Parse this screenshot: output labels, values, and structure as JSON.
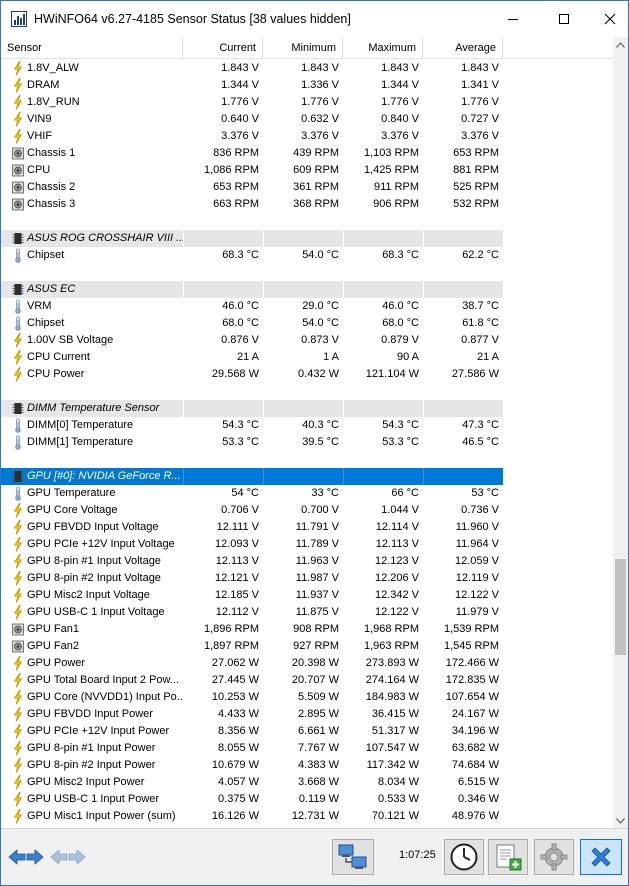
{
  "window": {
    "title": "HWiNFO64 v6.27-4185 Sensor Status [38 values hidden]",
    "minimize_icon": "minimize-icon",
    "maximize_icon": "maximize-icon",
    "close_icon": "close-icon"
  },
  "columns": [
    "Sensor",
    "Current",
    "Minimum",
    "Maximum",
    "Average"
  ],
  "rows": [
    {
      "kind": "data",
      "icon": "voltage",
      "label": "1.8V_ALW",
      "current": "1.843 V",
      "minimum": "1.843 V",
      "maximum": "1.843 V",
      "average": "1.843 V"
    },
    {
      "kind": "data",
      "icon": "voltage",
      "label": "DRAM",
      "current": "1.344 V",
      "minimum": "1.336 V",
      "maximum": "1.344 V",
      "average": "1.341 V"
    },
    {
      "kind": "data",
      "icon": "voltage",
      "label": "1.8V_RUN",
      "current": "1.776 V",
      "minimum": "1.776 V",
      "maximum": "1.776 V",
      "average": "1.776 V"
    },
    {
      "kind": "data",
      "icon": "voltage",
      "label": "VIN9",
      "current": "0.640 V",
      "minimum": "0.632 V",
      "maximum": "0.840 V",
      "average": "0.727 V"
    },
    {
      "kind": "data",
      "icon": "voltage",
      "label": "VHIF",
      "current": "3.376 V",
      "minimum": "3.376 V",
      "maximum": "3.376 V",
      "average": "3.376 V"
    },
    {
      "kind": "data",
      "icon": "fan",
      "label": "Chassis 1",
      "current": "836 RPM",
      "minimum": "439 RPM",
      "maximum": "1,103 RPM",
      "average": "653 RPM"
    },
    {
      "kind": "data",
      "icon": "fan",
      "label": "CPU",
      "current": "1,086 RPM",
      "minimum": "609 RPM",
      "maximum": "1,425 RPM",
      "average": "881 RPM"
    },
    {
      "kind": "data",
      "icon": "fan",
      "label": "Chassis 2",
      "current": "653 RPM",
      "minimum": "361 RPM",
      "maximum": "911 RPM",
      "average": "525 RPM"
    },
    {
      "kind": "data",
      "icon": "fan",
      "label": "Chassis 3",
      "current": "663 RPM",
      "minimum": "368 RPM",
      "maximum": "906 RPM",
      "average": "532 RPM"
    },
    {
      "kind": "blank"
    },
    {
      "kind": "group",
      "icon": "chip",
      "label": "ASUS ROG CROSSHAIR VIII ..."
    },
    {
      "kind": "data",
      "icon": "temperature",
      "label": "Chipset",
      "current": "68.3 °C",
      "minimum": "54.0 °C",
      "maximum": "68.3 °C",
      "average": "62.2 °C"
    },
    {
      "kind": "blank"
    },
    {
      "kind": "group",
      "icon": "chip",
      "label": "ASUS EC"
    },
    {
      "kind": "data",
      "icon": "temperature",
      "label": "VRM",
      "current": "46.0 °C",
      "minimum": "29.0 °C",
      "maximum": "46.0 °C",
      "average": "38.7 °C"
    },
    {
      "kind": "data",
      "icon": "temperature",
      "label": "Chipset",
      "current": "68.0 °C",
      "minimum": "54.0 °C",
      "maximum": "68.0 °C",
      "average": "61.8 °C"
    },
    {
      "kind": "data",
      "icon": "voltage",
      "label": "1.00V SB Voltage",
      "current": "0.876 V",
      "minimum": "0.873 V",
      "maximum": "0.879 V",
      "average": "0.877 V"
    },
    {
      "kind": "data",
      "icon": "voltage",
      "label": "CPU Current",
      "current": "21 A",
      "minimum": "1 A",
      "maximum": "90 A",
      "average": "21 A"
    },
    {
      "kind": "data",
      "icon": "voltage",
      "label": "CPU Power",
      "current": "29.568 W",
      "minimum": "0.432 W",
      "maximum": "121.104 W",
      "average": "27.586 W"
    },
    {
      "kind": "blank"
    },
    {
      "kind": "group",
      "icon": "chip",
      "label": "DIMM Temperature Sensor"
    },
    {
      "kind": "data",
      "icon": "temperature",
      "label": "DIMM[0] Temperature",
      "current": "54.3 °C",
      "minimum": "40.3 °C",
      "maximum": "54.3 °C",
      "average": "47.3 °C"
    },
    {
      "kind": "data",
      "icon": "temperature",
      "label": "DIMM[1] Temperature",
      "current": "53.3 °C",
      "minimum": "39.5 °C",
      "maximum": "53.3 °C",
      "average": "46.5 °C"
    },
    {
      "kind": "blank"
    },
    {
      "kind": "group",
      "icon": "chip",
      "label": "GPU [#0]: NVIDIA GeForce R...",
      "selected": true
    },
    {
      "kind": "data",
      "icon": "temperature",
      "label": "GPU Temperature",
      "current": "54 °C",
      "minimum": "33 °C",
      "maximum": "66 °C",
      "average": "53 °C"
    },
    {
      "kind": "data",
      "icon": "voltage",
      "label": "GPU Core Voltage",
      "current": "0.706 V",
      "minimum": "0.700 V",
      "maximum": "1.044 V",
      "average": "0.736 V"
    },
    {
      "kind": "data",
      "icon": "voltage",
      "label": "GPU FBVDD Input Voltage",
      "current": "12.111 V",
      "minimum": "11.791 V",
      "maximum": "12.114 V",
      "average": "11.960 V"
    },
    {
      "kind": "data",
      "icon": "voltage",
      "label": "GPU PCIe +12V Input Voltage",
      "current": "12.093 V",
      "minimum": "11.789 V",
      "maximum": "12.113 V",
      "average": "11.964 V"
    },
    {
      "kind": "data",
      "icon": "voltage",
      "label": "GPU 8-pin #1 Input Voltage",
      "current": "12.113 V",
      "minimum": "11.963 V",
      "maximum": "12.123 V",
      "average": "12.059 V"
    },
    {
      "kind": "data",
      "icon": "voltage",
      "label": "GPU 8-pin #2 Input Voltage",
      "current": "12.121 V",
      "minimum": "11.987 V",
      "maximum": "12.206 V",
      "average": "12.119 V"
    },
    {
      "kind": "data",
      "icon": "voltage",
      "label": "GPU Misc2 Input Voltage",
      "current": "12.185 V",
      "minimum": "11.937 V",
      "maximum": "12.342 V",
      "average": "12.122 V"
    },
    {
      "kind": "data",
      "icon": "voltage",
      "label": "GPU USB-C 1 Input Voltage",
      "current": "12.112 V",
      "minimum": "11.875 V",
      "maximum": "12.122 V",
      "average": "11.979 V"
    },
    {
      "kind": "data",
      "icon": "fan",
      "label": "GPU Fan1",
      "current": "1,896 RPM",
      "minimum": "908 RPM",
      "maximum": "1,968 RPM",
      "average": "1,539 RPM"
    },
    {
      "kind": "data",
      "icon": "fan",
      "label": "GPU Fan2",
      "current": "1,897 RPM",
      "minimum": "927 RPM",
      "maximum": "1,963 RPM",
      "average": "1,545 RPM"
    },
    {
      "kind": "data",
      "icon": "voltage",
      "label": "GPU Power",
      "current": "27.062 W",
      "minimum": "20.398 W",
      "maximum": "273.893 W",
      "average": "172.466 W"
    },
    {
      "kind": "data",
      "icon": "voltage",
      "label": "GPU Total Board Input 2 Pow...",
      "current": "27.445 W",
      "minimum": "20.707 W",
      "maximum": "274.164 W",
      "average": "172.835 W"
    },
    {
      "kind": "data",
      "icon": "voltage",
      "label": "GPU Core (NVVDD1) Input Po...",
      "current": "10.253 W",
      "minimum": "5.509 W",
      "maximum": "184.983 W",
      "average": "107.654 W"
    },
    {
      "kind": "data",
      "icon": "voltage",
      "label": "GPU FBVDD Input Power",
      "current": "4.433 W",
      "minimum": "2.895 W",
      "maximum": "36.415 W",
      "average": "24.167 W"
    },
    {
      "kind": "data",
      "icon": "voltage",
      "label": "GPU PCIe +12V Input Power",
      "current": "8.356 W",
      "minimum": "6.661 W",
      "maximum": "51.317 W",
      "average": "34.196 W"
    },
    {
      "kind": "data",
      "icon": "voltage",
      "label": "GPU 8-pin #1 Input Power",
      "current": "8.055 W",
      "minimum": "7.767 W",
      "maximum": "107.547 W",
      "average": "63.682 W"
    },
    {
      "kind": "data",
      "icon": "voltage",
      "label": "GPU 8-pin #2 Input Power",
      "current": "10.679 W",
      "minimum": "4.383 W",
      "maximum": "117.342 W",
      "average": "74.684 W"
    },
    {
      "kind": "data",
      "icon": "voltage",
      "label": "GPU Misc2 Input Power",
      "current": "4.057 W",
      "minimum": "3.668 W",
      "maximum": "8.034 W",
      "average": "6.515 W"
    },
    {
      "kind": "data",
      "icon": "voltage",
      "label": "GPU USB-C 1 Input Power",
      "current": "0.375 W",
      "minimum": "0.119 W",
      "maximum": "0.533 W",
      "average": "0.346 W"
    },
    {
      "kind": "data",
      "icon": "voltage",
      "label": "GPU Misc1 Input Power (sum)",
      "current": "16.126 W",
      "minimum": "12.731 W",
      "maximum": "70.121 W",
      "average": "48.976 W"
    }
  ],
  "toolbar": {
    "elapsed_time": "1:07:25",
    "buttons": [
      "nav-left-right-icon",
      "nav-disabled-icon",
      "network-icon",
      "clock-icon",
      "add-report-icon",
      "settings-gear-icon",
      "close-x-icon"
    ]
  },
  "colors": {
    "selection": "#0078d7",
    "group_background": "#e6e6e6",
    "voltage_icon": "#f5c400",
    "temperature_icon": "#8aa8c8"
  }
}
